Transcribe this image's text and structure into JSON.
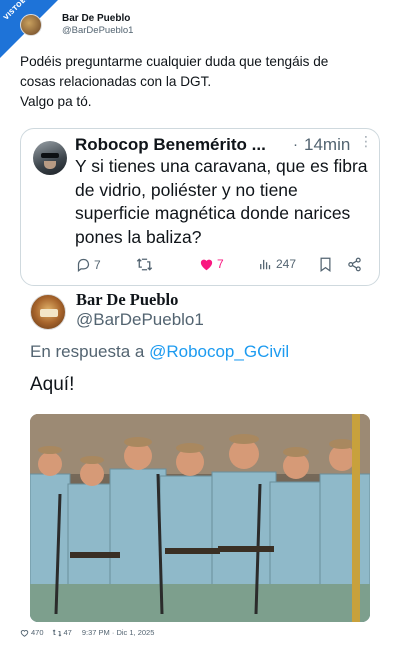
{
  "badge": {
    "text": "VISTOENLASREDES.com"
  },
  "header": {
    "name": "Bar De Pueblo",
    "handle": "@BarDePueblo1"
  },
  "main_tweet": {
    "line1": "Podéis preguntarme cualquier duda que tengáis de",
    "line2": "cosas relacionadas con la DGT.",
    "line3": "Valgo pa tó."
  },
  "quoted_tweet": {
    "author": "Robocop Benemérito ...",
    "dot": "·",
    "time": "14min",
    "more": "⋮",
    "text": "Y si tienes una caravana, que es fibra de vidrio, poliéster y no tiene superficie magnética donde narices pones la baliza?",
    "replies": "7",
    "likes": "7",
    "views": "247"
  },
  "reply_tweet": {
    "author": "Bar De Pueblo",
    "handle": "@BarDePueblo1",
    "in_reply_prefix": "En respuesta a ",
    "in_reply_handle": "@Robocop_GCivil",
    "text": "Aquí!"
  },
  "footer": {
    "likes": "470",
    "retweets": "47",
    "timestamp": "9:37 PM · Dic 1, 2025"
  },
  "colors": {
    "accent": "#1d9bf0",
    "like": "#f91880",
    "muted": "#536471",
    "badge": "#1e73d8"
  },
  "icons": [
    "reply-icon",
    "retweet-icon",
    "heart-icon",
    "views-icon",
    "bookmark-icon",
    "share-icon"
  ]
}
